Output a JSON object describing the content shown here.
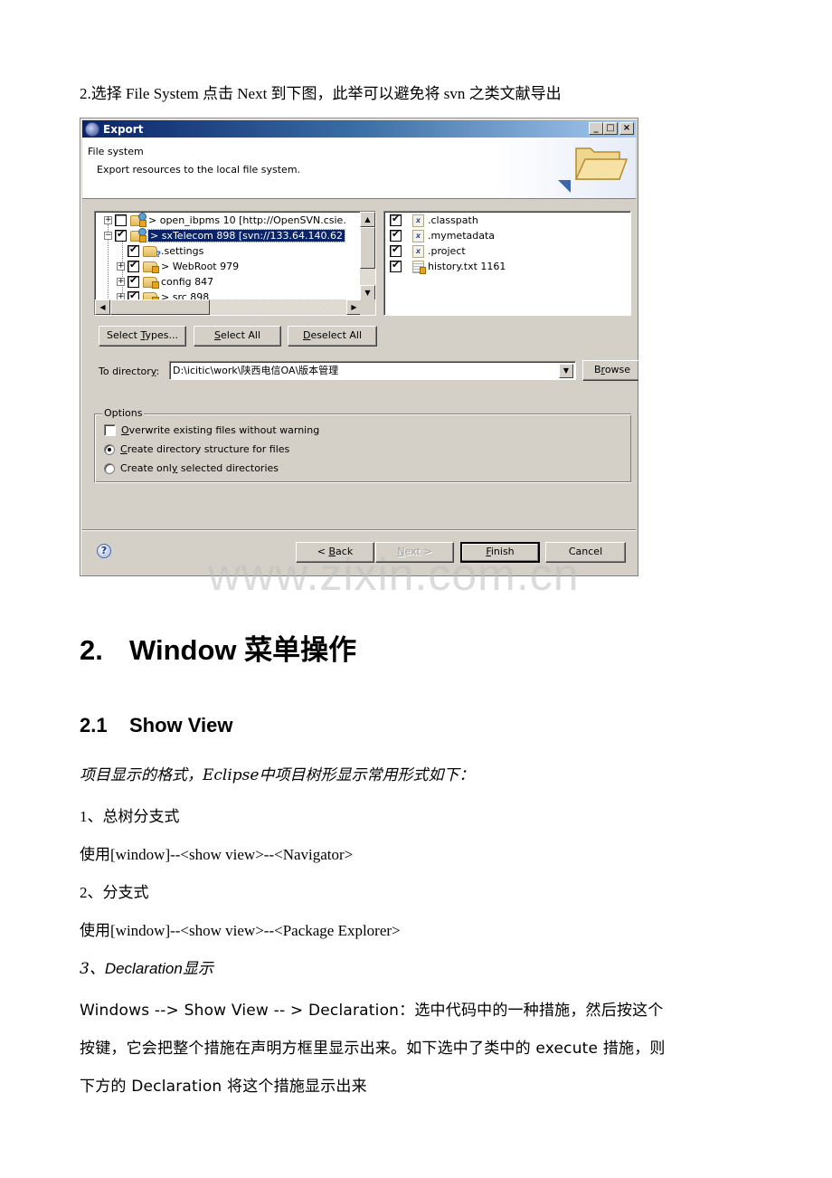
{
  "document": {
    "intro": "2.选择 File System 点击 Next 到下图，此举可以避免将 svn 之类文献导出",
    "heading1": {
      "number": "2.",
      "title": "Window 菜单操作"
    },
    "heading2": {
      "number": "2.1",
      "title": "Show View"
    },
    "subtitle": "项目显示的格式，Eclipse中项目树形显示常用形式如下：",
    "items": [
      {
        "label": "1、总树分支式",
        "usage": "使用[window]--<show view>--<Navigator>"
      },
      {
        "label": "2、分支式",
        "usage": "使用[window]--<show view>--<Package Explorer>"
      }
    ],
    "item3": {
      "number": "3、",
      "latin": "Declaration",
      "cjk": "显示"
    },
    "declaration_lines": [
      "Windows --> Show View -- > Declaration：选中代码中的一种措施，然后按这个",
      "按键，它会把整个措施在声明方框里显示出来。如下选中了类中的 execute 措施，则",
      "下方的 Declaration 将这个措施显示出来"
    ],
    "watermark": "www.zixin.com.cn"
  },
  "dialog": {
    "title": "Export",
    "window_controls": {
      "minimize": "_",
      "maximize": "□",
      "close": "×"
    },
    "banner": {
      "title": "File system",
      "description": "Export resources to the local file system."
    },
    "tree": [
      {
        "label": "> open_ibpms 10 [http://OpenSVN.csie.",
        "checked": false,
        "expander": "+",
        "selected": false
      },
      {
        "label": "> sxTelecom 898 [svn://133.64.140.62",
        "checked": true,
        "expander": "−",
        "selected": true
      },
      {
        "label": ".settings",
        "checked": true,
        "expander": "",
        "selected": false
      },
      {
        "label": "> WebRoot 979",
        "checked": true,
        "expander": "+",
        "selected": false
      },
      {
        "label": "config 847",
        "checked": true,
        "expander": "+",
        "selected": false
      },
      {
        "label": "> src 898",
        "checked": true,
        "expander": "+",
        "selected": false
      }
    ],
    "files": [
      {
        "label": ".classpath",
        "checked": true,
        "icon": "xml-file-icon"
      },
      {
        "label": ".mymetadata",
        "checked": true,
        "icon": "xml-file-icon"
      },
      {
        "label": ".project",
        "checked": true,
        "icon": "xml-file-icon"
      },
      {
        "label": "history.txt 1161",
        "checked": true,
        "icon": "text-file-icon"
      }
    ],
    "buttons": {
      "select_types": {
        "pre": "Select ",
        "mnemonic": "T",
        "post": "ypes..."
      },
      "select_all": {
        "pre": "",
        "mnemonic": "S",
        "post": "elect All"
      },
      "deselect_all": {
        "pre": "",
        "mnemonic": "D",
        "post": "eselect All"
      },
      "browse": {
        "pre": "B",
        "mnemonic": "r",
        "post": "owse"
      },
      "back": {
        "pre": "< ",
        "mnemonic": "B",
        "post": "ack"
      },
      "next": {
        "pre": "",
        "mnemonic": "N",
        "post": "ext >"
      },
      "finish": {
        "pre": "",
        "mnemonic": "F",
        "post": "inish"
      },
      "cancel": {
        "pre": "Cancel",
        "mnemonic": "",
        "post": ""
      }
    },
    "to_directory": {
      "label_pre": "To director",
      "label_mnemonic": "y",
      "label_post": ":",
      "value": "D:\\icitic\\work\\陕西电信OA\\版本管理"
    },
    "options": {
      "legend": "Options",
      "overwrite": {
        "pre": "",
        "mnemonic": "O",
        "post": "verwrite existing files without warning",
        "checked": false
      },
      "create_structure": {
        "pre": "",
        "mnemonic": "C",
        "post": "reate directory structure for files",
        "selected": true
      },
      "create_selected": {
        "pre": "Create onl",
        "mnemonic": "y",
        "post": " selected directories",
        "selected": false
      }
    },
    "help": "?"
  }
}
